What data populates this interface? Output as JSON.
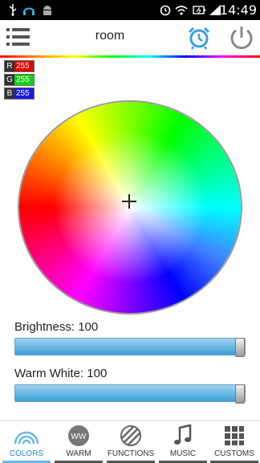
{
  "status": {
    "time": "14:49",
    "left_icons": [
      "usb-icon",
      "headset-icon",
      "android-icon"
    ],
    "right_icons": [
      "alarm-icon",
      "wifi-icon",
      "battery-icon",
      "signal-icon"
    ]
  },
  "appbar": {
    "title": "room",
    "icons": [
      "menu-icon",
      "alarm-icon",
      "power-icon"
    ]
  },
  "rgb": [
    {
      "key": "R",
      "value": "255",
      "color": "#e00000"
    },
    {
      "key": "G",
      "value": "255",
      "color": "#12d012"
    },
    {
      "key": "B",
      "value": "255",
      "color": "#1a1ae0"
    }
  ],
  "sliders": {
    "brightness": {
      "label": "Brightness: 100",
      "value": 100,
      "max": 100
    },
    "warm_white": {
      "label": "Warm White: 100",
      "value": 100,
      "max": 100
    }
  },
  "tabs": [
    {
      "label": "COLORS",
      "icon": "rainbow-icon",
      "active": true
    },
    {
      "label": "WARM",
      "icon": "ww-icon",
      "active": false
    },
    {
      "label": "FUNCTIONS",
      "icon": "stripes-icon",
      "active": false
    },
    {
      "label": "MUSIC",
      "icon": "music-note-icon",
      "active": false
    },
    {
      "label": "CUSTOMS",
      "icon": "grid-icon",
      "active": false
    }
  ],
  "colors": {
    "accent": "#2a8ad8",
    "slider_fill": "#3a9fd6"
  }
}
